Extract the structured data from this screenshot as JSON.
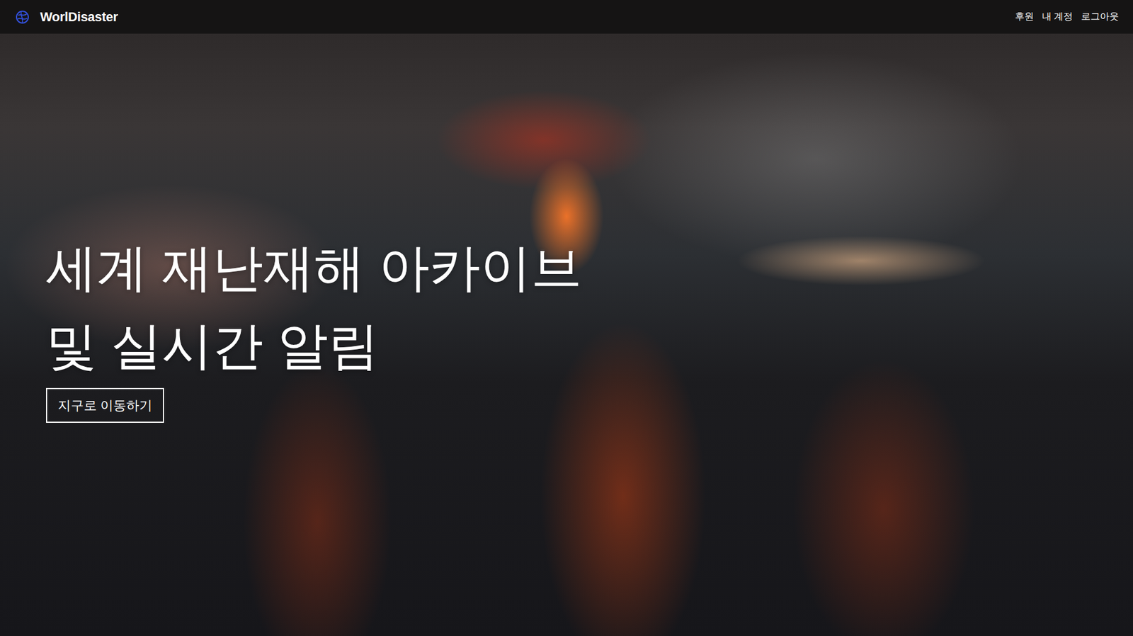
{
  "header": {
    "logo": "WorlDisaster",
    "nav": [
      {
        "label": "후원"
      },
      {
        "label": "내 계정"
      },
      {
        "label": "로그아웃"
      }
    ]
  },
  "hero": {
    "title_lines": [
      "세계 재난재해 아카이브",
      "및 실시간 알림"
    ],
    "button": "지구로 이동하기"
  }
}
